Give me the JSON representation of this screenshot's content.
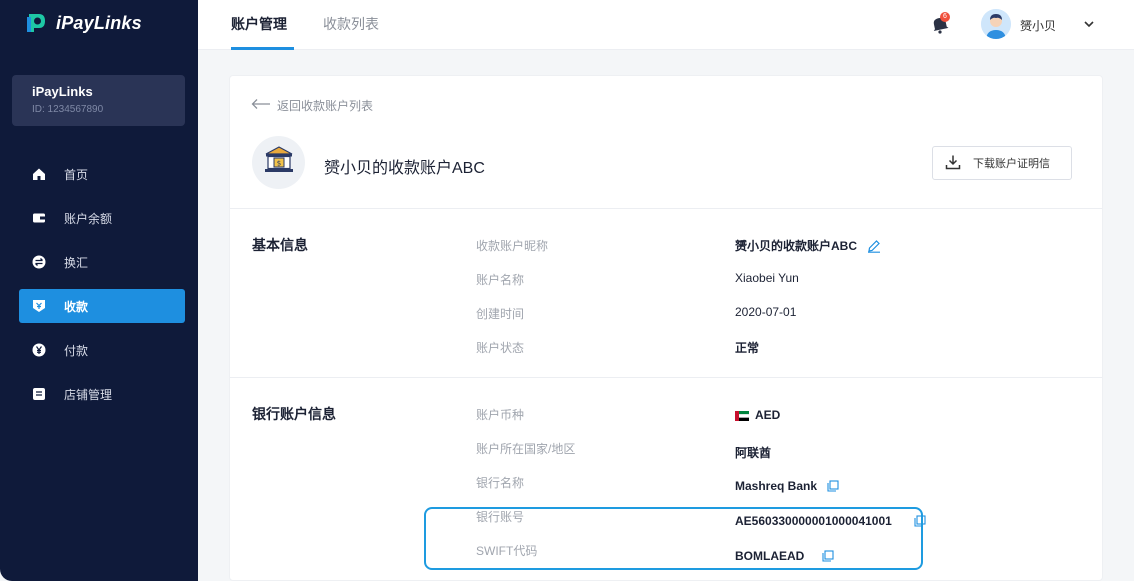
{
  "brand": {
    "name": "iPayLinks"
  },
  "account": {
    "name": "iPayLinks",
    "id": "ID: 1234567890"
  },
  "nav": [
    {
      "label": "首页",
      "icon": "home-icon",
      "active": false
    },
    {
      "label": "账户余额",
      "icon": "wallet-icon",
      "active": false
    },
    {
      "label": "换汇",
      "icon": "exchange-icon",
      "active": false
    },
    {
      "label": "收款",
      "icon": "receive-icon",
      "active": true
    },
    {
      "label": "付款",
      "icon": "yen-icon",
      "active": false
    },
    {
      "label": "店铺管理",
      "icon": "store-icon",
      "active": false
    }
  ],
  "topbar": {
    "tabs": [
      {
        "label": "账户管理",
        "active": true
      },
      {
        "label": "收款列表",
        "active": false
      }
    ],
    "badge": "6",
    "user": "赟小贝"
  },
  "page": {
    "back": "返回收款账户列表",
    "title": "赟小贝的收款账户ABC",
    "download": "下载账户证明信"
  },
  "basic": {
    "title": "基本信息",
    "rows": [
      {
        "label": "收款账户昵称",
        "value": "赟小贝的收款账户ABC"
      },
      {
        "label": "账户名称",
        "value": "Xiaobei Yun"
      },
      {
        "label": "创建时间",
        "value": "2020-07-01"
      },
      {
        "label": "账户状态",
        "value": "正常"
      }
    ]
  },
  "bank": {
    "title": "银行账户信息",
    "rows": [
      {
        "label": "账户币种",
        "value": "AED"
      },
      {
        "label": "账户所在国家/地区",
        "value": "阿联酋"
      },
      {
        "label": "银行名称",
        "value": "Mashreq Bank"
      },
      {
        "label": "银行账号",
        "value": "AE560330000001000041001"
      },
      {
        "label": "SWIFT代码",
        "value": "BOMLAEAD"
      }
    ]
  },
  "colors": {
    "sidebar": "#0f1a3a",
    "accent": "#1e8fe0",
    "highlight": "#1e9be0"
  }
}
